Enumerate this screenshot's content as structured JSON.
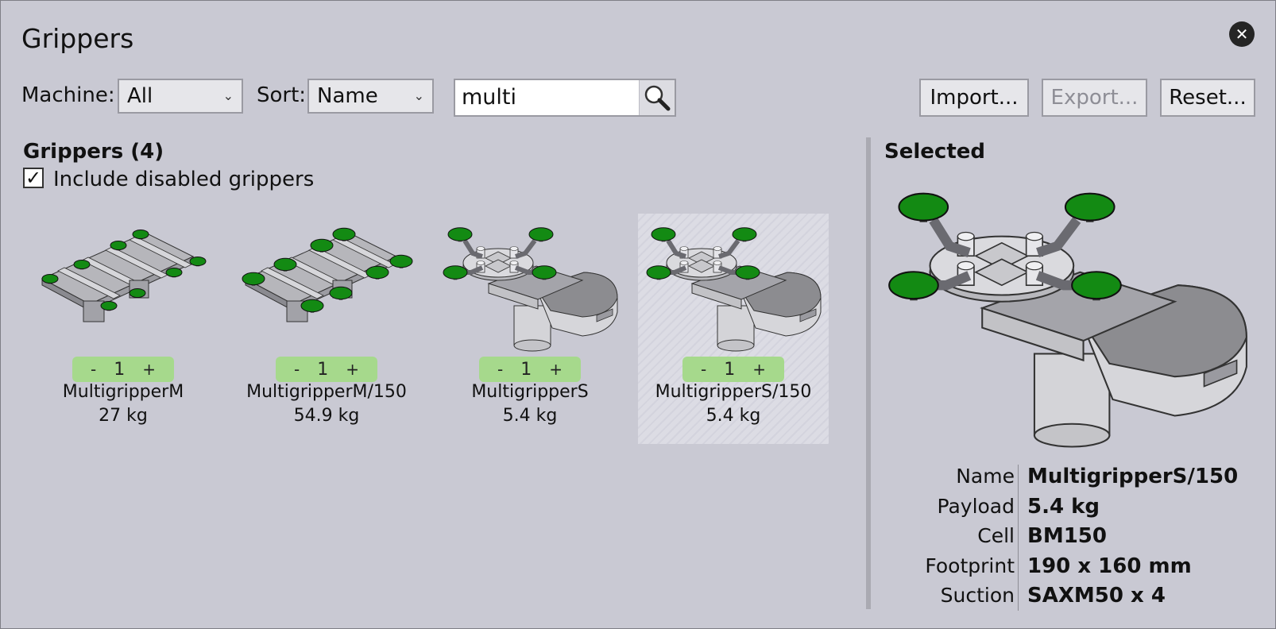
{
  "window": {
    "title": "Grippers"
  },
  "toolbar": {
    "machine_label": "Machine:",
    "machine_value": "All",
    "sort_label": "Sort:",
    "sort_value": "Name",
    "search_value": "multi",
    "import_label": "Import...",
    "export_label": "Export...",
    "reset_label": "Reset..."
  },
  "list": {
    "header": "Grippers (4)",
    "include_disabled_label": "Include disabled grippers",
    "include_disabled_checked": true,
    "items": [
      {
        "name": "MultigripperM",
        "weight": "27 kg",
        "qty": "1",
        "selected": false,
        "kind": "M"
      },
      {
        "name": "MultigripperM/150",
        "weight": "54.9 kg",
        "qty": "1",
        "selected": false,
        "kind": "M150"
      },
      {
        "name": "MultigripperS",
        "weight": "5.4 kg",
        "qty": "1",
        "selected": false,
        "kind": "S"
      },
      {
        "name": "MultigripperS/150",
        "weight": "5.4 kg",
        "qty": "1",
        "selected": true,
        "kind": "S"
      }
    ],
    "minus_label": "-",
    "plus_label": "+"
  },
  "selected": {
    "header": "Selected",
    "properties": [
      {
        "key": "Name",
        "value": "MultigripperS/150"
      },
      {
        "key": "Payload",
        "value": "5.4 kg"
      },
      {
        "key": "Cell",
        "value": "BM150"
      },
      {
        "key": "Footprint",
        "value": "190 x 160 mm"
      },
      {
        "key": "Suction",
        "value": "SAXM50 x 4"
      }
    ]
  },
  "colors": {
    "background": "#c9c9d3",
    "suction_cup": "#138a13",
    "counter": "#a6d98c"
  }
}
